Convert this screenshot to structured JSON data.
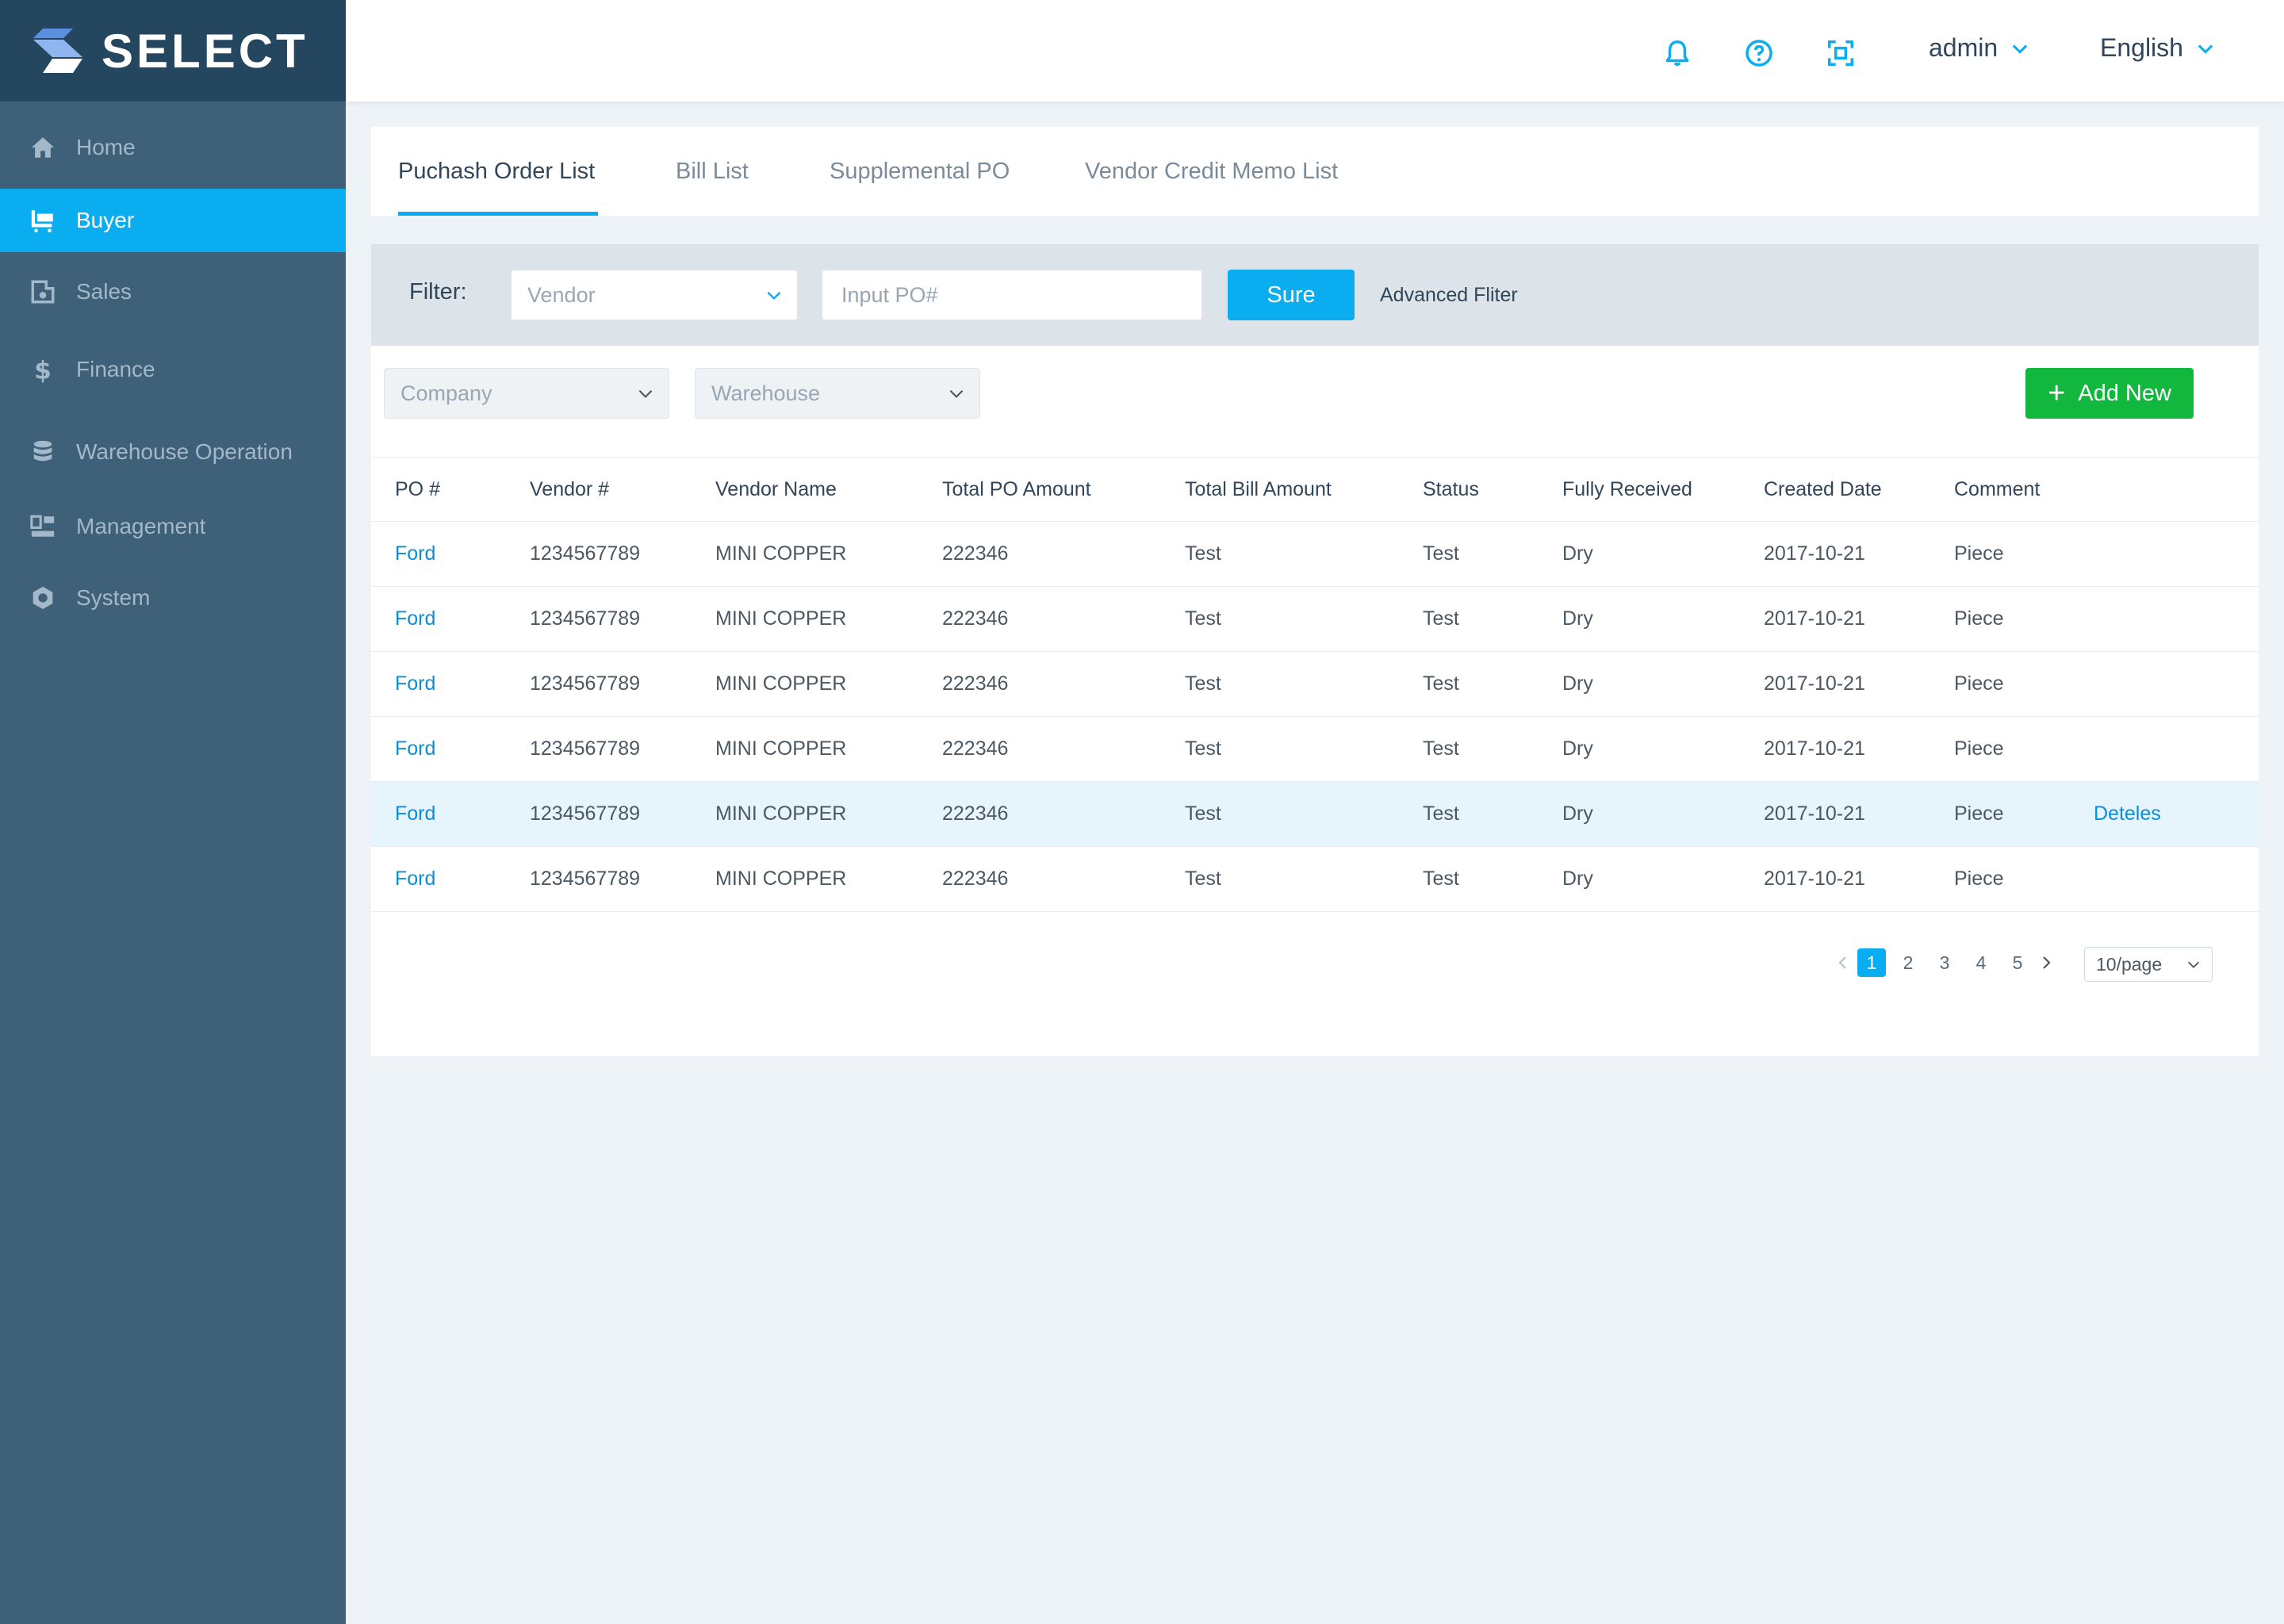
{
  "brand": {
    "name": "SELECT"
  },
  "sidebar": {
    "items": [
      {
        "label": "Home",
        "icon": "home-icon",
        "active": false
      },
      {
        "label": "Buyer",
        "icon": "cart-icon",
        "active": true
      },
      {
        "label": "Sales",
        "icon": "sales-icon",
        "active": false
      },
      {
        "label": "Finance",
        "icon": "dollar-icon",
        "active": false
      },
      {
        "label": "Warehouse Operation",
        "icon": "database-icon",
        "active": false
      },
      {
        "label": "Management",
        "icon": "management-icon",
        "active": false
      },
      {
        "label": "System",
        "icon": "settings-icon",
        "active": false
      }
    ]
  },
  "header": {
    "icons": [
      "bell-icon",
      "help-icon",
      "scan-icon"
    ],
    "user": "admin",
    "language": "English"
  },
  "tabs": [
    {
      "label": "Puchash Order List",
      "active": true
    },
    {
      "label": "Bill List",
      "active": false
    },
    {
      "label": "Supplemental PO",
      "active": false
    },
    {
      "label": "Vendor Credit Memo List",
      "active": false
    }
  ],
  "filter": {
    "label": "Filter:",
    "vendor_placeholder": "Vendor",
    "po_placeholder": "Input PO#",
    "sure_label": "Sure",
    "advanced_label": "Advanced Fliter",
    "company_placeholder": "Company",
    "warehouse_placeholder": "Warehouse",
    "add_label": "Add New"
  },
  "table": {
    "columns": [
      "PO #",
      "Vendor #",
      "Vendor Name",
      "Total PO Amount",
      "Total Bill Amount",
      "Status",
      "Fully Received",
      "Created Date",
      "Comment"
    ],
    "rows": [
      {
        "po": "Ford",
        "vendor_no": "1234567789",
        "vendor_name": "MINI COPPER",
        "total_po": "222346",
        "total_bill": "Test",
        "status": "Test",
        "fully_received": "Dry",
        "created": "2017-10-21",
        "comment": "Piece",
        "action": ""
      },
      {
        "po": "Ford",
        "vendor_no": "1234567789",
        "vendor_name": "MINI COPPER",
        "total_po": "222346",
        "total_bill": "Test",
        "status": "Test",
        "fully_received": "Dry",
        "created": "2017-10-21",
        "comment": "Piece",
        "action": ""
      },
      {
        "po": "Ford",
        "vendor_no": "1234567789",
        "vendor_name": "MINI COPPER",
        "total_po": "222346",
        "total_bill": "Test",
        "status": "Test",
        "fully_received": "Dry",
        "created": "2017-10-21",
        "comment": "Piece",
        "action": ""
      },
      {
        "po": "Ford",
        "vendor_no": "1234567789",
        "vendor_name": "MINI COPPER",
        "total_po": "222346",
        "total_bill": "Test",
        "status": "Test",
        "fully_received": "Dry",
        "created": "2017-10-21",
        "comment": "Piece",
        "action": ""
      },
      {
        "po": "Ford",
        "vendor_no": "1234567789",
        "vendor_name": "MINI COPPER",
        "total_po": "222346",
        "total_bill": "Test",
        "status": "Test",
        "fully_received": "Dry",
        "created": "2017-10-21",
        "comment": "Piece",
        "action": "Deteles"
      },
      {
        "po": "Ford",
        "vendor_no": "1234567789",
        "vendor_name": "MINI COPPER",
        "total_po": "222346",
        "total_bill": "Test",
        "status": "Test",
        "fully_received": "Dry",
        "created": "2017-10-21",
        "comment": "Piece",
        "action": ""
      }
    ]
  },
  "pagination": {
    "pages": [
      "1",
      "2",
      "3",
      "4",
      "5"
    ],
    "current": "1",
    "page_size": "10/page"
  },
  "colors": {
    "accent": "#0aaef0",
    "sidebar": "#3e6079",
    "brand_bar": "#24475f",
    "add_button": "#12b83e",
    "link": "#0a8fd6"
  }
}
